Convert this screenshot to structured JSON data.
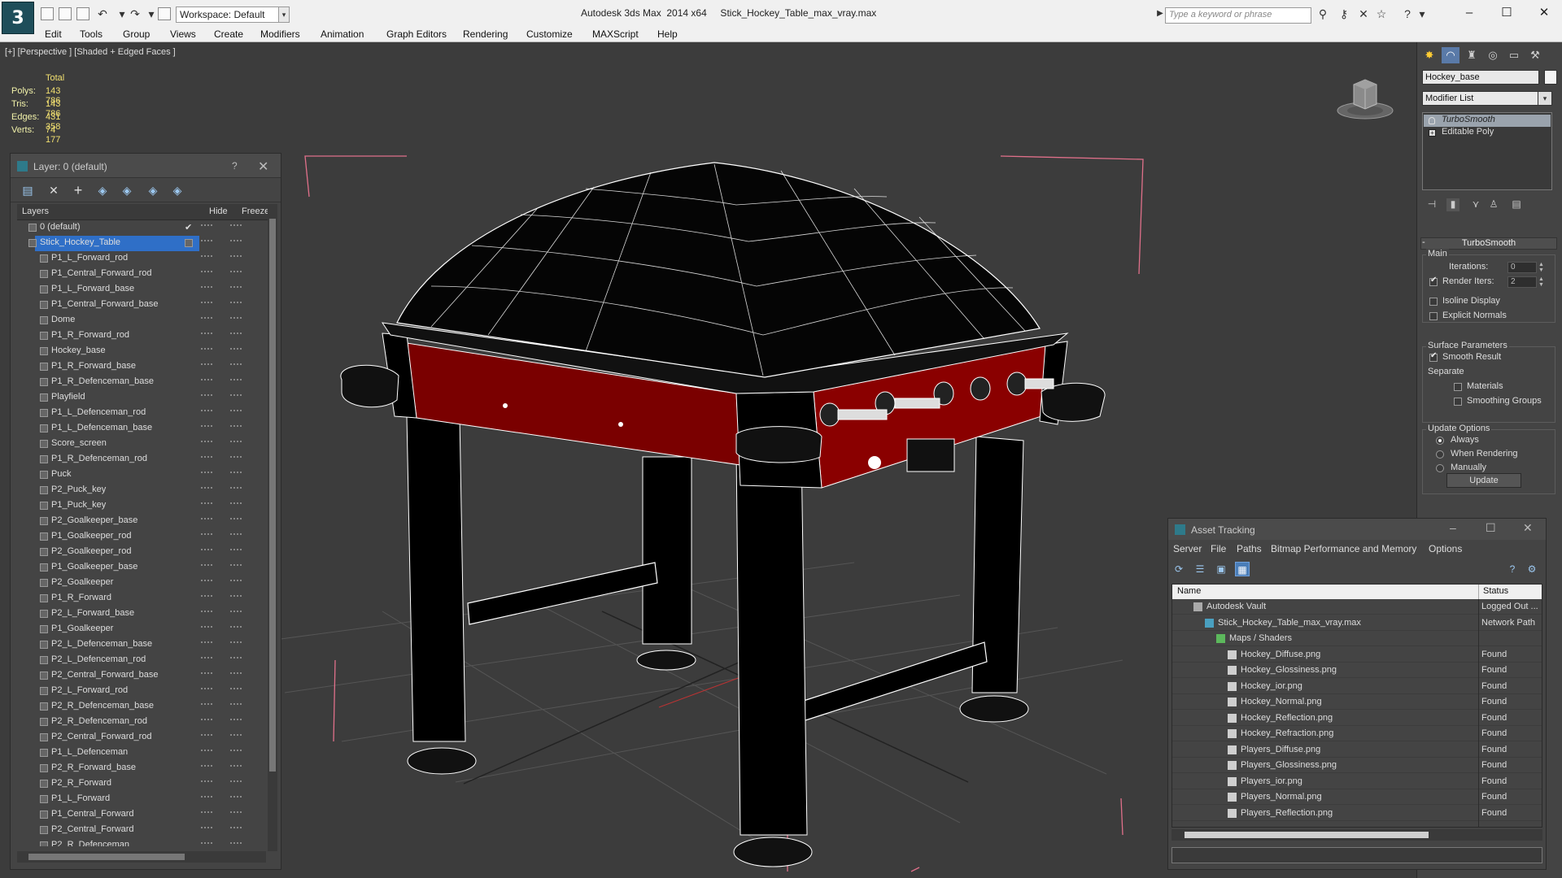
{
  "app": {
    "title": "Autodesk 3ds Max  2014 x64     Stick_Hockey_Table_max_vray.max",
    "logo_glyph": "3",
    "workspace": "Workspace: Default",
    "search_placeholder": "Type a keyword or phrase"
  },
  "menu": [
    "Edit",
    "Tools",
    "Group",
    "Views",
    "Create",
    "Modifiers",
    "Animation",
    "Graph Editors",
    "Rendering",
    "Customize",
    "MAXScript",
    "Help"
  ],
  "viewport": {
    "label": "[+] [Perspective ] [Shaded + Edged Faces ]",
    "stats_header": "Total",
    "stats": [
      {
        "label": "Polys:",
        "value": "143 786"
      },
      {
        "label": "Tris:",
        "value": "143 786"
      },
      {
        "label": "Edges:",
        "value": "431 358"
      },
      {
        "label": "Verts:",
        "value": "74 177"
      }
    ],
    "colors": {
      "background": "#3c3c3c",
      "wire": "#ffffff",
      "body_red": "#8a0000",
      "selection_bracket": "#e0708a"
    }
  },
  "layer_panel": {
    "title": "Layer: 0 (default)",
    "help": "?",
    "columns": {
      "layers": "Layers",
      "hide": "Hide",
      "freeze": "Freeze"
    },
    "layers": [
      {
        "name": "0 (default)",
        "level": 0,
        "checked": true
      },
      {
        "name": "Stick_Hockey_Table",
        "level": 0,
        "selected": true
      },
      {
        "name": "P1_L_Forward_rod",
        "level": 1
      },
      {
        "name": "P1_Central_Forward_rod",
        "level": 1
      },
      {
        "name": "P1_L_Forward_base",
        "level": 1
      },
      {
        "name": "P1_Central_Forward_base",
        "level": 1
      },
      {
        "name": "Dome",
        "level": 1
      },
      {
        "name": "P1_R_Forward_rod",
        "level": 1
      },
      {
        "name": "Hockey_base",
        "level": 1
      },
      {
        "name": "P1_R_Forward_base",
        "level": 1
      },
      {
        "name": "P1_R_Defenceman_base",
        "level": 1
      },
      {
        "name": "Playfield",
        "level": 1
      },
      {
        "name": "P1_L_Defenceman_rod",
        "level": 1
      },
      {
        "name": "P1_L_Defenceman_base",
        "level": 1
      },
      {
        "name": "Score_screen",
        "level": 1
      },
      {
        "name": "P1_R_Defenceman_rod",
        "level": 1
      },
      {
        "name": "Puck",
        "level": 1
      },
      {
        "name": "P2_Puck_key",
        "level": 1
      },
      {
        "name": "P1_Puck_key",
        "level": 1
      },
      {
        "name": "P2_Goalkeeper_base",
        "level": 1
      },
      {
        "name": "P1_Goalkeeper_rod",
        "level": 1
      },
      {
        "name": "P2_Goalkeeper_rod",
        "level": 1
      },
      {
        "name": "P1_Goalkeeper_base",
        "level": 1
      },
      {
        "name": "P2_Goalkeeper",
        "level": 1
      },
      {
        "name": "P1_R_Forward",
        "level": 1
      },
      {
        "name": "P2_L_Forward_base",
        "level": 1
      },
      {
        "name": "P1_Goalkeeper",
        "level": 1
      },
      {
        "name": "P2_L_Defenceman_base",
        "level": 1
      },
      {
        "name": "P2_L_Defenceman_rod",
        "level": 1
      },
      {
        "name": "P2_Central_Forward_base",
        "level": 1
      },
      {
        "name": "P2_L_Forward_rod",
        "level": 1
      },
      {
        "name": "P2_R_Defenceman_base",
        "level": 1
      },
      {
        "name": "P2_R_Defenceman_rod",
        "level": 1
      },
      {
        "name": "P2_Central_Forward_rod",
        "level": 1
      },
      {
        "name": "P1_L_Defenceman",
        "level": 1
      },
      {
        "name": "P2_R_Forward_base",
        "level": 1
      },
      {
        "name": "P2_R_Forward",
        "level": 1
      },
      {
        "name": "P1_L_Forward",
        "level": 1
      },
      {
        "name": "P1_Central_Forward",
        "level": 1
      },
      {
        "name": "P2_Central_Forward",
        "level": 1
      },
      {
        "name": "P2_R_Defenceman",
        "level": 1
      }
    ]
  },
  "command_panel": {
    "object_name": "Hockey_base",
    "modifier_list": "Modifier List",
    "stack": [
      {
        "name": "TurboSmooth",
        "selected": true
      },
      {
        "name": "Editable Poly",
        "selected": false
      }
    ],
    "rollout": {
      "title": "TurboSmooth",
      "collapse": "-",
      "main_group": "Main",
      "iterations_label": "Iterations:",
      "iterations_value": "0",
      "render_iters_label": "Render Iters:",
      "render_iters_value": "2",
      "render_iters_checked": true,
      "isoline": "Isoline Display",
      "explicit_normals": "Explicit Normals",
      "surface_group": "Surface Parameters",
      "smooth_result": "Smooth Result",
      "separate": "Separate",
      "materials": "Materials",
      "smoothing_groups": "Smoothing Groups",
      "update_group": "Update Options",
      "always": "Always",
      "when_rendering": "When Rendering",
      "manually": "Manually",
      "update_button": "Update"
    }
  },
  "asset_tracking": {
    "title": "Asset Tracking",
    "menu": [
      "Server",
      "File",
      "Paths",
      "Bitmap Performance and Memory",
      "Options"
    ],
    "columns": {
      "name": "Name",
      "status": "Status"
    },
    "rows": [
      {
        "name": "Autodesk Vault",
        "status": "Logged Out ...",
        "level": 0,
        "icon": "vault-icon"
      },
      {
        "name": "Stick_Hockey_Table_max_vray.max",
        "status": "Network Path",
        "level": 1,
        "icon": "max-file-icon"
      },
      {
        "name": "Maps / Shaders",
        "status": "",
        "level": 2,
        "icon": "maps-icon"
      },
      {
        "name": "Hockey_Diffuse.png",
        "status": "Found",
        "level": 3,
        "icon": "bitmap-icon"
      },
      {
        "name": "Hockey_Glossiness.png",
        "status": "Found",
        "level": 3,
        "icon": "bitmap-icon"
      },
      {
        "name": "Hockey_ior.png",
        "status": "Found",
        "level": 3,
        "icon": "bitmap-icon"
      },
      {
        "name": "Hockey_Normal.png",
        "status": "Found",
        "level": 3,
        "icon": "bitmap-icon"
      },
      {
        "name": "Hockey_Reflection.png",
        "status": "Found",
        "level": 3,
        "icon": "bitmap-icon"
      },
      {
        "name": "Hockey_Refraction.png",
        "status": "Found",
        "level": 3,
        "icon": "bitmap-icon"
      },
      {
        "name": "Players_Diffuse.png",
        "status": "Found",
        "level": 3,
        "icon": "bitmap-icon"
      },
      {
        "name": "Players_Glossiness.png",
        "status": "Found",
        "level": 3,
        "icon": "bitmap-icon"
      },
      {
        "name": "Players_ior.png",
        "status": "Found",
        "level": 3,
        "icon": "bitmap-icon"
      },
      {
        "name": "Players_Normal.png",
        "status": "Found",
        "level": 3,
        "icon": "bitmap-icon"
      },
      {
        "name": "Players_Reflection.png",
        "status": "Found",
        "level": 3,
        "icon": "bitmap-icon"
      }
    ]
  }
}
